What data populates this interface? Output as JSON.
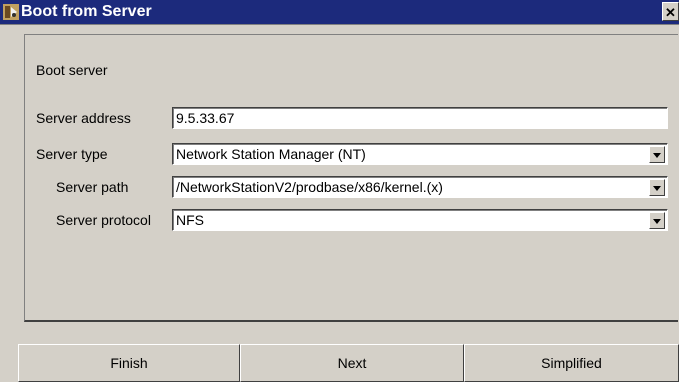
{
  "window": {
    "title": "Boot from Server",
    "close_glyph": "✕",
    "icon": "app-icon"
  },
  "section": {
    "label": "Boot server"
  },
  "fields": [
    {
      "label": "Server address",
      "value": "9.5.33.67",
      "type": "text"
    },
    {
      "label": "Server type",
      "value": "Network Station Manager (NT)",
      "type": "select"
    },
    {
      "label": "Server path",
      "value": "/NetworkStationV2/prodbase/x86/kernel.(x)",
      "type": "select"
    },
    {
      "label": "Server protocol",
      "value": "NFS",
      "type": "select"
    }
  ],
  "buttons": {
    "finish": "Finish",
    "next": "Next",
    "simplified": "Simplified"
  },
  "colors": {
    "titlebar": "#1c2a7c",
    "background": "#d4d0c8"
  }
}
